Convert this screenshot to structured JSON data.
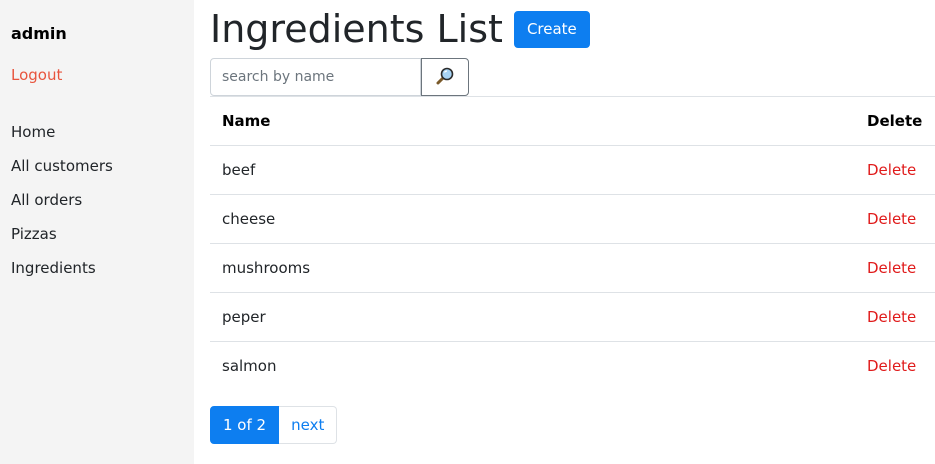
{
  "sidebar": {
    "username": "admin",
    "logout_label": "Logout",
    "items": [
      {
        "label": "Home"
      },
      {
        "label": "All customers"
      },
      {
        "label": "All orders"
      },
      {
        "label": "Pizzas"
      },
      {
        "label": "Ingredients"
      }
    ]
  },
  "header": {
    "title": "Ingredients List",
    "create_label": "Create"
  },
  "search": {
    "placeholder": "search by name",
    "value": "",
    "button_icon": "magnifier-icon"
  },
  "table": {
    "columns": [
      "Name",
      "Delete"
    ],
    "rows": [
      {
        "name": "beef",
        "action": "Delete"
      },
      {
        "name": "cheese",
        "action": "Delete"
      },
      {
        "name": "mushrooms",
        "action": "Delete"
      },
      {
        "name": "peper",
        "action": "Delete"
      },
      {
        "name": "salmon",
        "action": "Delete"
      }
    ]
  },
  "pagination": {
    "current_label": "1 of 2",
    "next_label": "next"
  },
  "colors": {
    "primary": "#0d7ef0",
    "danger": "#e01b1b",
    "logout": "#e8553e",
    "sidebar_bg": "#f4f4f4"
  }
}
